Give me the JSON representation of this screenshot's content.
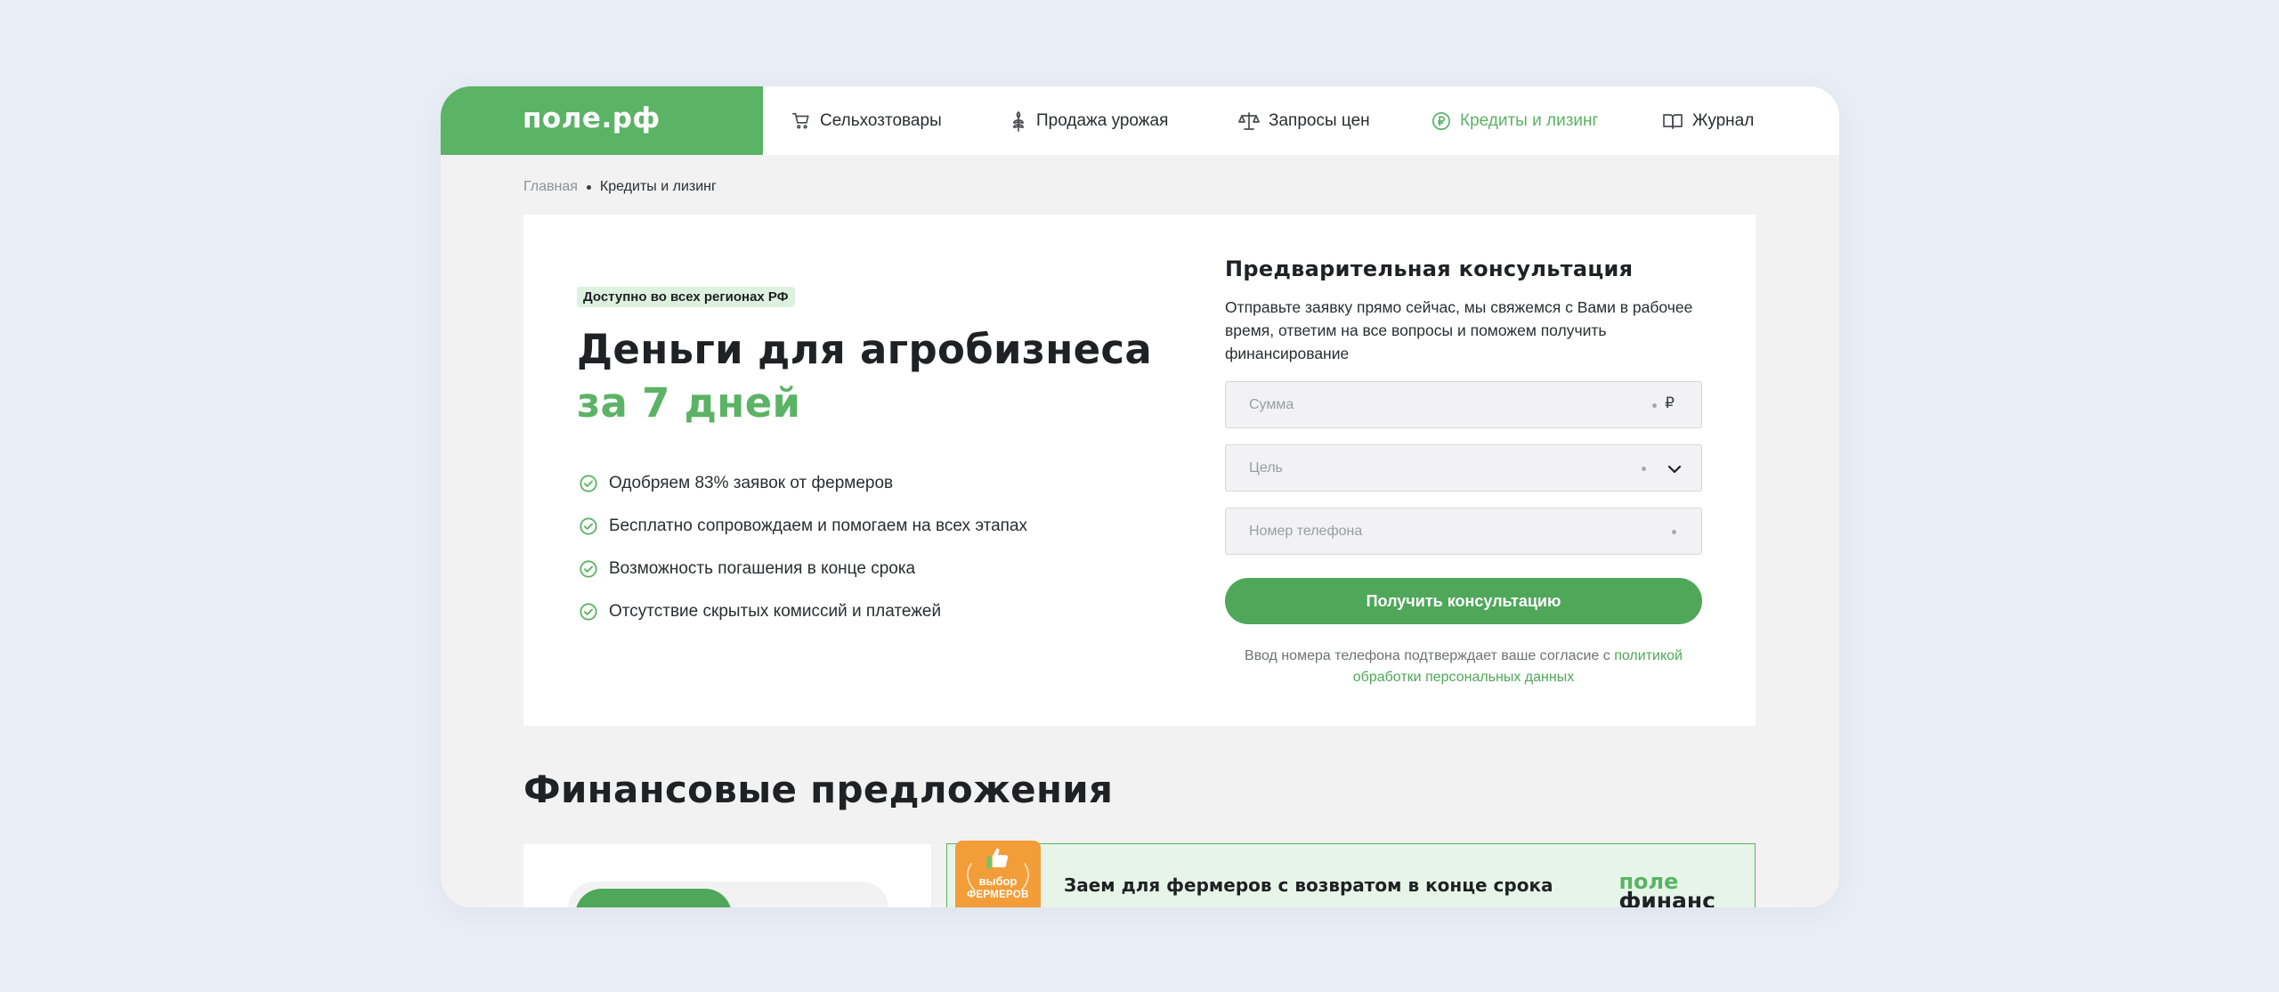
{
  "header": {
    "logo": "поле.рф",
    "nav": [
      {
        "label": "Сельхозтовары",
        "icon": "cart-icon"
      },
      {
        "label": "Продажа урожая",
        "icon": "wheat-icon"
      },
      {
        "label": "Запросы цен",
        "icon": "scales-icon"
      },
      {
        "label": "Кредиты и лизинг",
        "icon": "ruble-icon",
        "active": true
      },
      {
        "label": "Журнал",
        "icon": "book-icon"
      }
    ]
  },
  "breadcrumb": {
    "home": "Главная",
    "current": "Кредиты и лизинг"
  },
  "hero": {
    "badge": "Доступно во всех регионах РФ",
    "title_line1": "Деньги для агробизнеса",
    "title_line2": "за 7 дней",
    "features": [
      "Одобряем 83% заявок от фермеров",
      "Бесплатно сопровождаем и помогаем на всех этапах",
      "Возможность погашения в конце срока",
      "Отсутствие скрытых комиссий и платежей"
    ]
  },
  "form": {
    "title": "Предварительная консультация",
    "description": "Отправьте заявку прямо сейчас, мы свяжемся с Вами в рабочее время, ответим на все вопросы и поможем получить финансирование",
    "amount": {
      "placeholder": "Сумма",
      "value": "",
      "suffix": "₽"
    },
    "purpose": {
      "placeholder": "Цель",
      "value": ""
    },
    "phone": {
      "placeholder": "Номер телефона",
      "value": ""
    },
    "submit_label": "Получить консультацию",
    "consent_text": "Ввод номера телефона подтверждает ваше согласие с ",
    "consent_link": "политикой обработки персональных данных"
  },
  "offers": {
    "title": "Финансовые предложения",
    "featured": {
      "award_line1": "выбор",
      "award_line2": "ФЕРМЕРОВ",
      "title": "Заем для фермеров с возвратом в конце срока",
      "partner_logo_line1": "поле",
      "partner_logo_line2": "финанс"
    }
  },
  "colors": {
    "brand_green": "#5bb365",
    "button_green": "#4fa75a",
    "badge_bg": "#ddf1df",
    "award_orange": "#f29d38"
  }
}
